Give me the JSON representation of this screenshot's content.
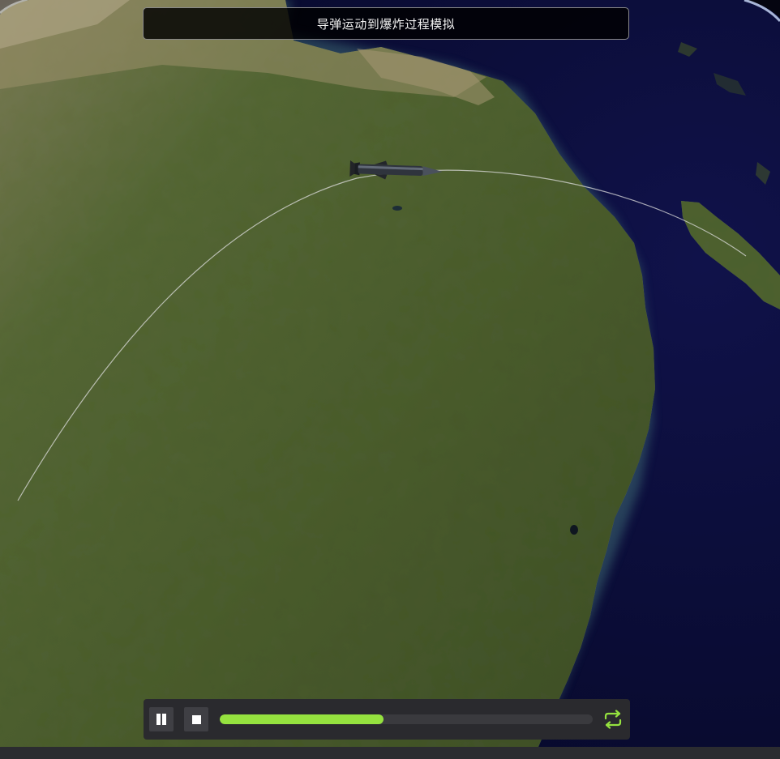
{
  "title": "导弹运动到爆炸过程模拟",
  "controls": {
    "pause_icon": "pause-icon",
    "stop_icon": "stop-icon",
    "loop_icon": "loop-icon",
    "progress": 0.44
  },
  "colors": {
    "progress_fill": "#95e23f",
    "loop_icon": "#95e23f",
    "ocean": "#0a0c2e",
    "land": "#4c5d2f",
    "trajectory": "#d8d8d8"
  },
  "scene": {
    "object_icon": "missile-icon"
  }
}
